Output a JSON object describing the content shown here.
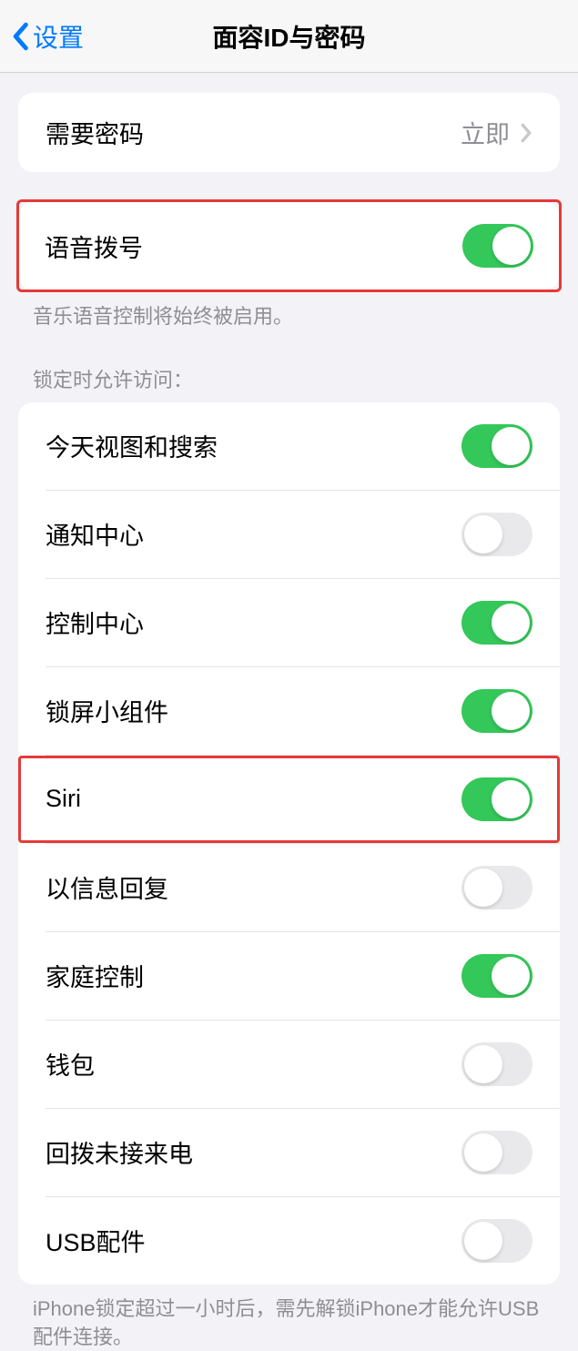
{
  "nav": {
    "back_label": "设置",
    "title": "面容ID与密码"
  },
  "passcode_row": {
    "label": "需要密码",
    "value": "立即"
  },
  "voice_dial": {
    "label": "语音拨号",
    "on": true,
    "footer": "音乐语音控制将始终被启用。"
  },
  "lock_access": {
    "header": "锁定时允许访问：",
    "items": [
      {
        "label": "今天视图和搜索",
        "on": true,
        "highlighted": false
      },
      {
        "label": "通知中心",
        "on": false,
        "highlighted": false
      },
      {
        "label": "控制中心",
        "on": true,
        "highlighted": false
      },
      {
        "label": "锁屏小组件",
        "on": true,
        "highlighted": false
      },
      {
        "label": "Siri",
        "on": true,
        "highlighted": true
      },
      {
        "label": "以信息回复",
        "on": false,
        "highlighted": false
      },
      {
        "label": "家庭控制",
        "on": true,
        "highlighted": false
      },
      {
        "label": "钱包",
        "on": false,
        "highlighted": false
      },
      {
        "label": "回拨未接来电",
        "on": false,
        "highlighted": false
      },
      {
        "label": "USB配件",
        "on": false,
        "highlighted": false
      }
    ],
    "footer": "iPhone锁定超过一小时后，需先解锁iPhone才能允许USB配件连接。"
  }
}
